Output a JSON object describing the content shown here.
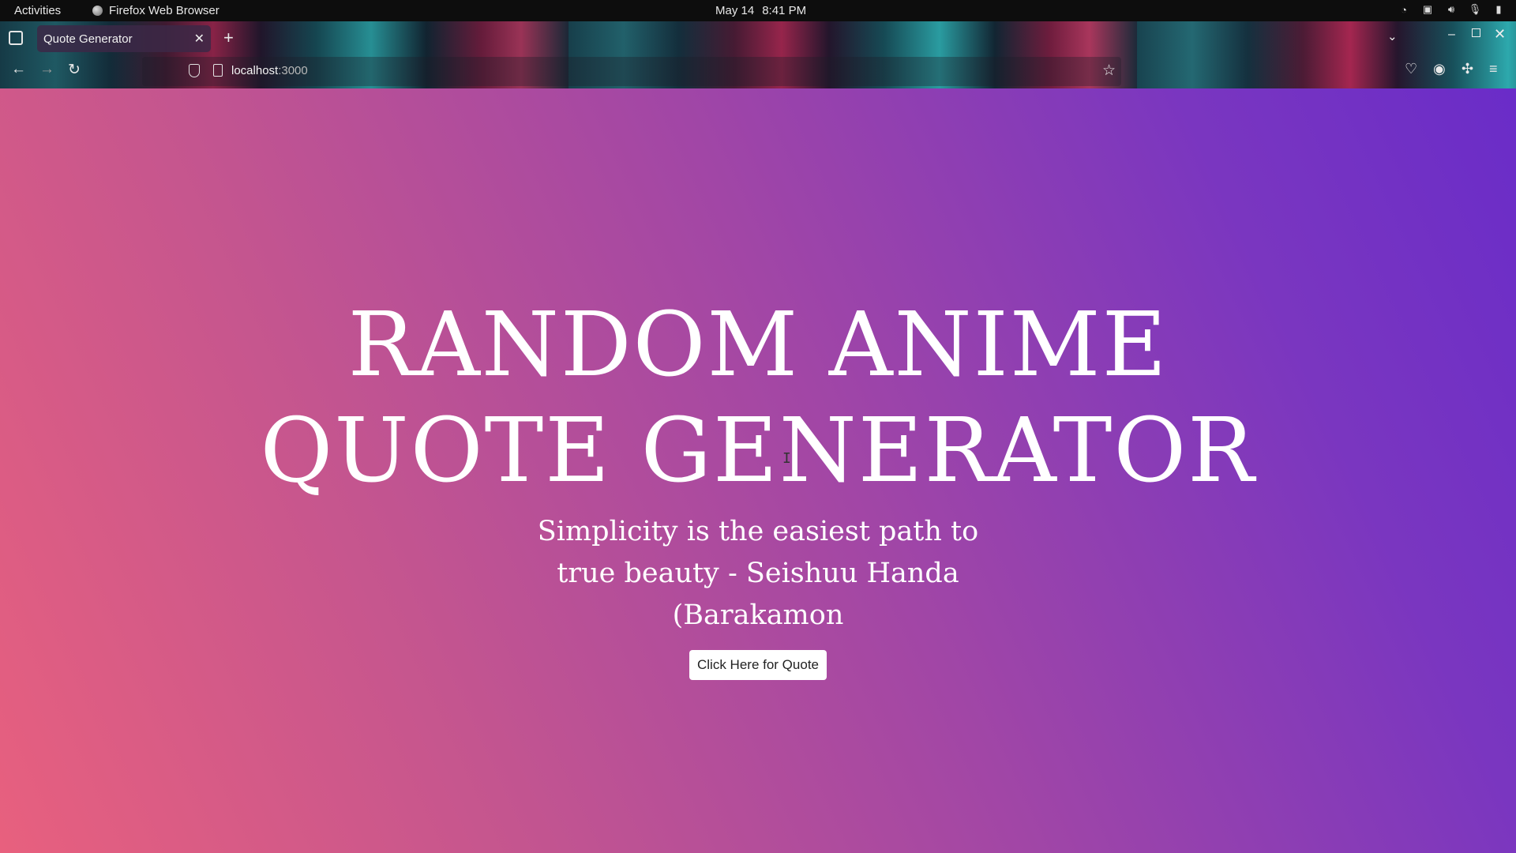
{
  "system_bar": {
    "activities": "Activities",
    "app_name": "Firefox Web Browser",
    "date": "May 14",
    "time": "8:41 PM"
  },
  "browser": {
    "tab_title": "Quote Generator",
    "url_host": "localhost",
    "url_port": ":3000"
  },
  "page": {
    "headline_line1": "RANDOM ANIME",
    "headline_line2": "QUOTE GENERATOR",
    "quote_line1": "Simplicity is the easiest path to",
    "quote_line2": "true beauty - Seishuu Handa",
    "quote_line3": "(Barakamon",
    "button_label": "Click Here for Quote"
  },
  "colors": {
    "gradient_start": "#e8607e",
    "gradient_end": "#6a2cc8",
    "text": "#ffffff"
  }
}
